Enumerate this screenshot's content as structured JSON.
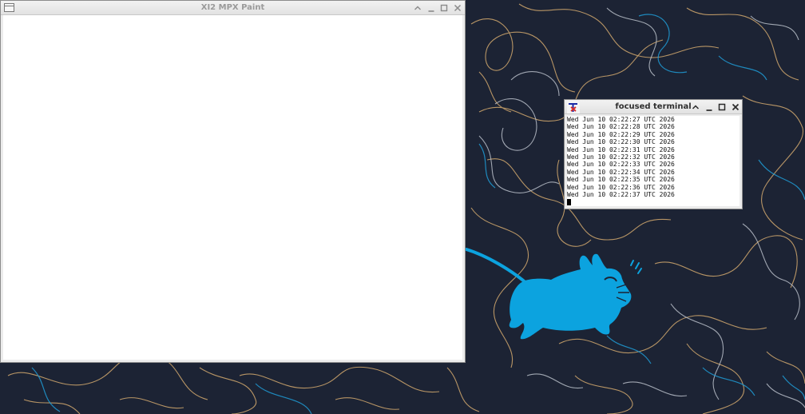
{
  "desktop": {
    "background_color": "#1c2334",
    "contour_colors": [
      "#c9a26b",
      "#b9bfc9",
      "#1f95cc"
    ],
    "mascot": {
      "name": "xfce-mouse-logo",
      "color": "#0ca3df"
    }
  },
  "paint_window": {
    "title": "XI2 MPX Paint",
    "state": "inactive",
    "buttons": {
      "menu": "window-menu-icon",
      "shade": "chevron-up-icon",
      "minimize": "minimize-icon",
      "maximize": "maximize-icon",
      "close": "close-icon"
    }
  },
  "terminal_window": {
    "title": "focused terminal",
    "state": "active",
    "icon": "xterm-icon",
    "buttons": {
      "shade": "chevron-up-icon",
      "minimize": "minimize-icon",
      "maximize": "maximize-icon",
      "close": "close-icon"
    },
    "lines": [
      "Wed Jun 10 02:22:27 UTC 2026",
      "Wed Jun 10 02:22:28 UTC 2026",
      "Wed Jun 10 02:22:29 UTC 2026",
      "Wed Jun 10 02:22:30 UTC 2026",
      "Wed Jun 10 02:22:31 UTC 2026",
      "Wed Jun 10 02:22:32 UTC 2026",
      "Wed Jun 10 02:22:33 UTC 2026",
      "Wed Jun 10 02:22:34 UTC 2026",
      "Wed Jun 10 02:22:35 UTC 2026",
      "Wed Jun 10 02:22:36 UTC 2026",
      "Wed Jun 10 02:22:37 UTC 2026"
    ],
    "cursor": "block-cursor"
  }
}
